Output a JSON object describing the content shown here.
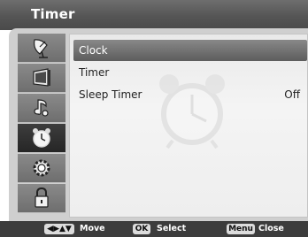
{
  "header": {
    "title": "Timer"
  },
  "sidebar": {
    "items": [
      {
        "icon": "satellite-dish-icon",
        "active": false
      },
      {
        "icon": "tv-picture-icon",
        "active": false
      },
      {
        "icon": "audio-note-icon",
        "active": false
      },
      {
        "icon": "alarm-clock-icon",
        "active": true
      },
      {
        "icon": "gear-icon",
        "active": false
      },
      {
        "icon": "padlock-icon",
        "active": false
      }
    ]
  },
  "menu": {
    "items": [
      {
        "label": "Clock",
        "value": "",
        "selected": true
      },
      {
        "label": "Timer",
        "value": "",
        "selected": false
      },
      {
        "label": "Sleep Timer",
        "value": "Off",
        "selected": false
      }
    ],
    "watermark_icon": "alarm-clock-icon"
  },
  "footer": {
    "nav_key": "◀▶▲▼",
    "move_label": "Move",
    "ok_key": "OK",
    "select_label": "Select",
    "menu_key": "Menu",
    "close_label": "Close"
  },
  "colors": {
    "title_bar": "#555555",
    "frame": "#cfcfcf",
    "selected_row": "#6e6e6e",
    "active_side_item": "#2e2e2e",
    "footer": "#3c3c3c"
  }
}
